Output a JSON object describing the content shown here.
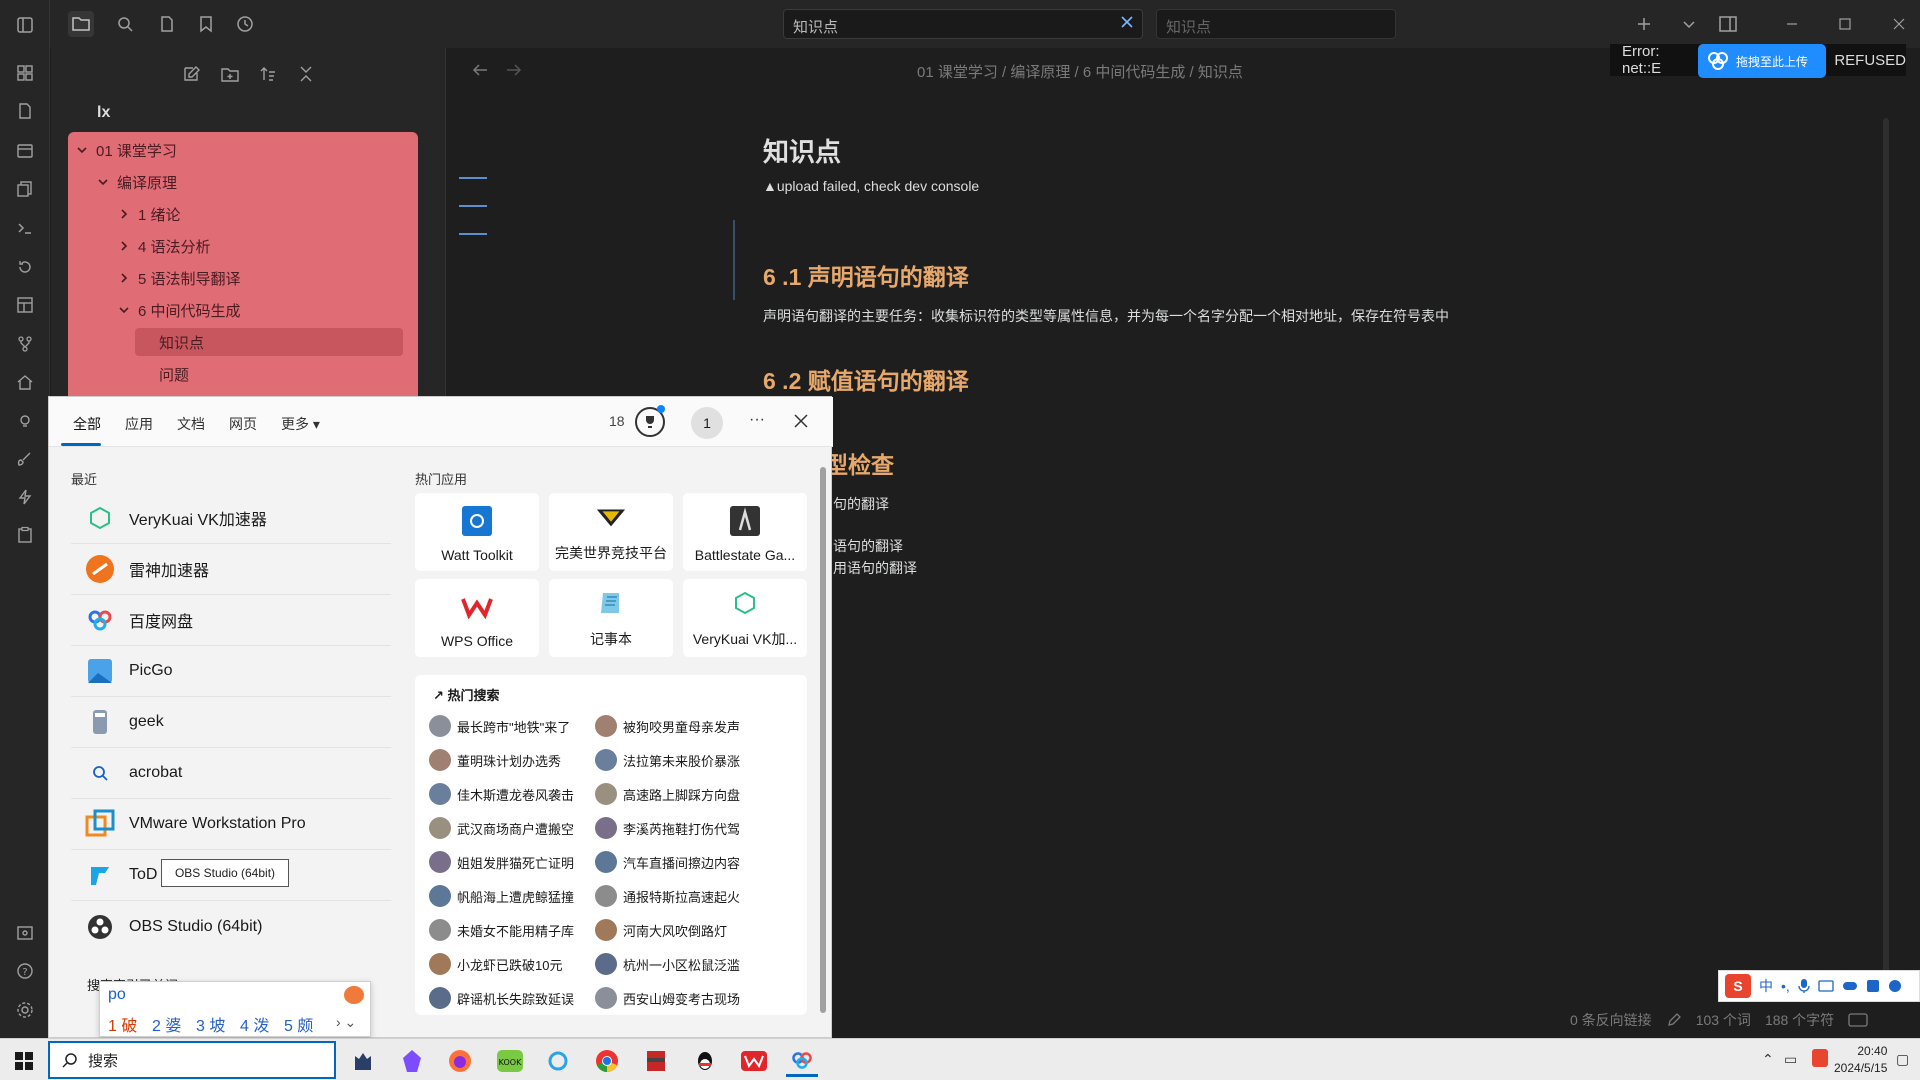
{
  "topbar": {
    "tab_active": "知识点",
    "tab_search_placeholder": "知识点"
  },
  "sidebar": {
    "vault_name": "lx",
    "tree": [
      {
        "label": "01 课堂学习",
        "expanded": true,
        "level": 0
      },
      {
        "label": "编译原理",
        "expanded": true,
        "level": 1
      },
      {
        "label": "1 绪论",
        "expanded": false,
        "level": 2
      },
      {
        "label": "4 语法分析",
        "expanded": false,
        "level": 2
      },
      {
        "label": "5 语法制导翻译",
        "expanded": false,
        "level": 2
      },
      {
        "label": "6 中间代码生成",
        "expanded": true,
        "level": 2
      },
      {
        "label": "知识点",
        "selected": true,
        "level": 3
      },
      {
        "label": "问题",
        "level": 3
      }
    ]
  },
  "editor": {
    "breadcrumb": "01 课堂学习 / 编译原理 / 6 中间代码生成 / 知识点",
    "title": "知识点",
    "warning": "upload failed, check dev console",
    "h2_1": "6 .1 声明语句的翻译",
    "para1": "声明语句翻译的主要任务：收集标识符的类型等属性信息，并为每一个名字分配一个相对地址，保存在符号表中",
    "h2_2": "6 .2 赋值语句的翻译",
    "h2_3_partial": "型检查",
    "partial_1": "句的翻译",
    "partial_2": "语句的翻译",
    "partial_3": "用语句的翻译",
    "error_text": "Error: net::E",
    "error_suffix": "REFUSED",
    "upload_label": "拖拽至此上传",
    "status": {
      "backlinks": "0 条反向链接",
      "words": "103 个词",
      "chars": "188 个字符"
    }
  },
  "search_panel": {
    "tabs": [
      "全部",
      "应用",
      "文档",
      "网页",
      "更多"
    ],
    "points": "18",
    "user_initial": "1",
    "recent_header": "最近",
    "recent": [
      {
        "name": "VeryKuai VK加速器",
        "icon": "verykuai-icon"
      },
      {
        "name": "雷神加速器",
        "icon": "leishen-icon"
      },
      {
        "name": "百度网盘",
        "icon": "baidu-netdisk-icon"
      },
      {
        "name": "PicGo",
        "icon": "picgo-icon"
      },
      {
        "name": "geek",
        "icon": "geek-icon"
      },
      {
        "name": "acrobat",
        "icon": "search-icon"
      },
      {
        "name": "VMware Workstation Pro",
        "icon": "vmware-icon"
      },
      {
        "name": "ToD",
        "icon": "todesk-icon"
      },
      {
        "name": "OBS Studio (64bit)",
        "icon": "obs-icon"
      }
    ],
    "tooltip": "OBS Studio (64bit)",
    "hot_apps_header": "热门应用",
    "hot_apps": [
      {
        "name": "Watt Toolkit",
        "color": "#1677d2"
      },
      {
        "name": "完美世界竞技平台",
        "color": "#d4a800"
      },
      {
        "name": "Battlestate Ga...",
        "color": "#333333"
      },
      {
        "name": "WPS Office",
        "color": "#e0262b"
      },
      {
        "name": "记事本",
        "color": "#5ab0d8"
      },
      {
        "name": "VeryKuai VK加...",
        "color": "#2bbf8a"
      }
    ],
    "hot_search_header": "热门搜索",
    "hot_search": [
      [
        "最长跨市\"地铁\"来了",
        "被狗咬男童母亲发声"
      ],
      [
        "董明珠计划办选秀",
        "法拉第未来股价暴涨"
      ],
      [
        "佳木斯遭龙卷风袭击",
        "高速路上脚踩方向盘"
      ],
      [
        "武汉商场商户遭搬空",
        "李溪芮拖鞋打伤代驾"
      ],
      [
        "姐姐发胖猫死亡证明",
        "汽车直播间擦边内容"
      ],
      [
        "帆船海上遭虎鲸猛撞",
        "通报特斯拉高速起火"
      ],
      [
        "未婚女不能用精子库",
        "河南大风吹倒路灯"
      ],
      [
        "小龙虾已跌破10元",
        "杭州一小区松鼠泛滥"
      ],
      [
        "辟谣机长失踪致延误",
        "西安山姆变考古现场"
      ]
    ],
    "search_index_off": "搜索索引已关闭",
    "ime": {
      "input": "po",
      "candidates": [
        "1 破",
        "2 婆",
        "3 坡",
        "4 泼",
        "5 颇"
      ]
    }
  },
  "taskbar": {
    "search_placeholder": "搜索",
    "time": "20:40",
    "date": "2024/5/15",
    "ime_mode": "中"
  }
}
